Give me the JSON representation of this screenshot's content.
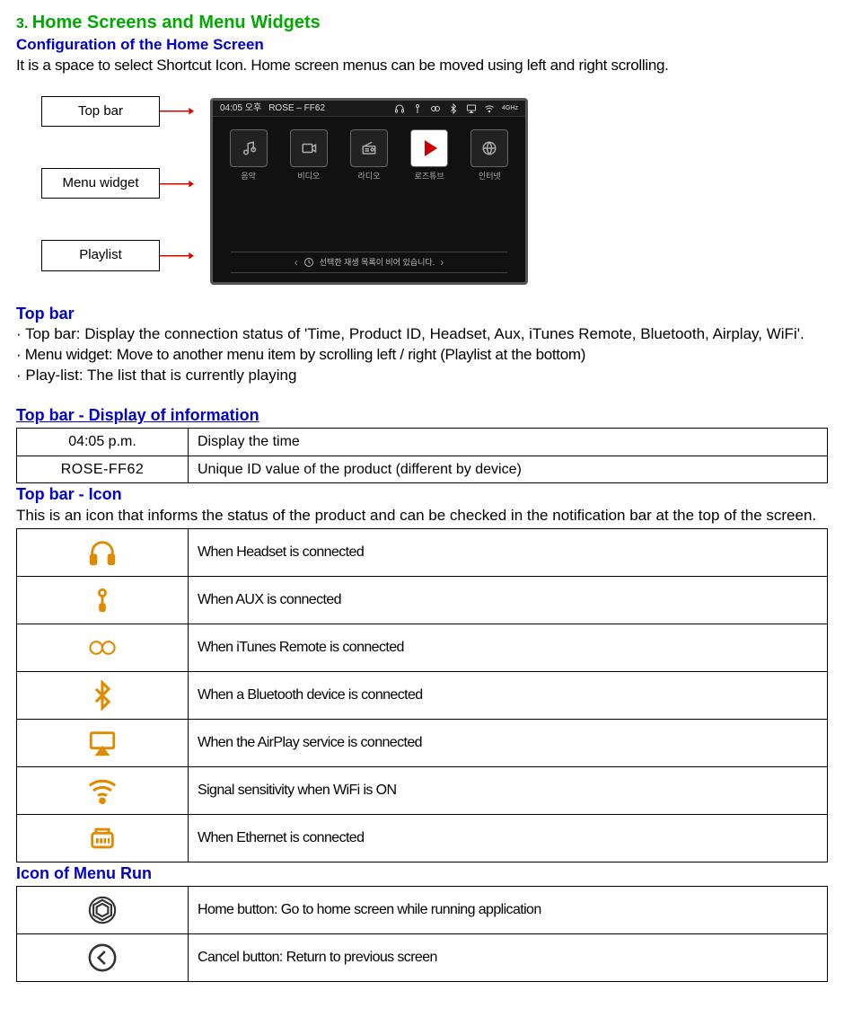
{
  "header": {
    "number": "3.",
    "title": "Home Screens and Menu Widgets",
    "config_title": "Configuration of the Home Screen",
    "intro": "It is a space to select Shortcut Icon.  Home screen menus can be moved using left and right scrolling."
  },
  "diagram": {
    "labels": {
      "topbar": "Top bar",
      "menu": "Menu widget",
      "playlist": "Playlist"
    },
    "topbar_left": "04:05 오후",
    "topbar_title": "ROSE – FF62",
    "wifi_label": "4GHz",
    "playlist_text": "선택한 재생 목록이 비어 있습니다.",
    "widgets": [
      "음악",
      "비디오",
      "라디오",
      "로즈튜브",
      "인터넷"
    ]
  },
  "topbar_section": {
    "heading": "Top bar",
    "bullets": {
      "b1": "Top bar: Display the connection status of 'Time, Product ID, Headset, Aux, iTunes Remote, Bluetooth, Airplay, WiFi'.",
      "b2": "Menu widget: Move to another menu item by scrolling left / right (Playlist at the bottom)",
      "b3": "Play-list: The list that is currently playing"
    }
  },
  "info_table": {
    "heading": "Top bar - Display of information",
    "rows": [
      {
        "label": "04:05 p.m.",
        "desc": "Display the time"
      },
      {
        "label": "ROSE-FF62",
        "desc": "Unique ID value of the product (different by device)"
      }
    ]
  },
  "icon_section": {
    "heading": "Top bar - Icon",
    "intro": "This is an icon that informs the status of the product and can be checked in the notification bar at the top of the screen.",
    "rows": [
      {
        "desc": "When Headset is connected"
      },
      {
        "desc": "When AUX is connected"
      },
      {
        "desc": "When iTunes Remote is connected"
      },
      {
        "desc": "When a Bluetooth device is connected"
      },
      {
        "desc": "When the AirPlay service is connected"
      },
      {
        "desc": "Signal sensitivity when WiFi is ON"
      },
      {
        "desc": "When Ethernet is connected"
      }
    ]
  },
  "menu_run": {
    "heading": "Icon of Menu Run",
    "rows": [
      {
        "desc": "Home button: Go to home screen while running application"
      },
      {
        "desc": "Cancel button: Return to previous screen"
      }
    ]
  }
}
